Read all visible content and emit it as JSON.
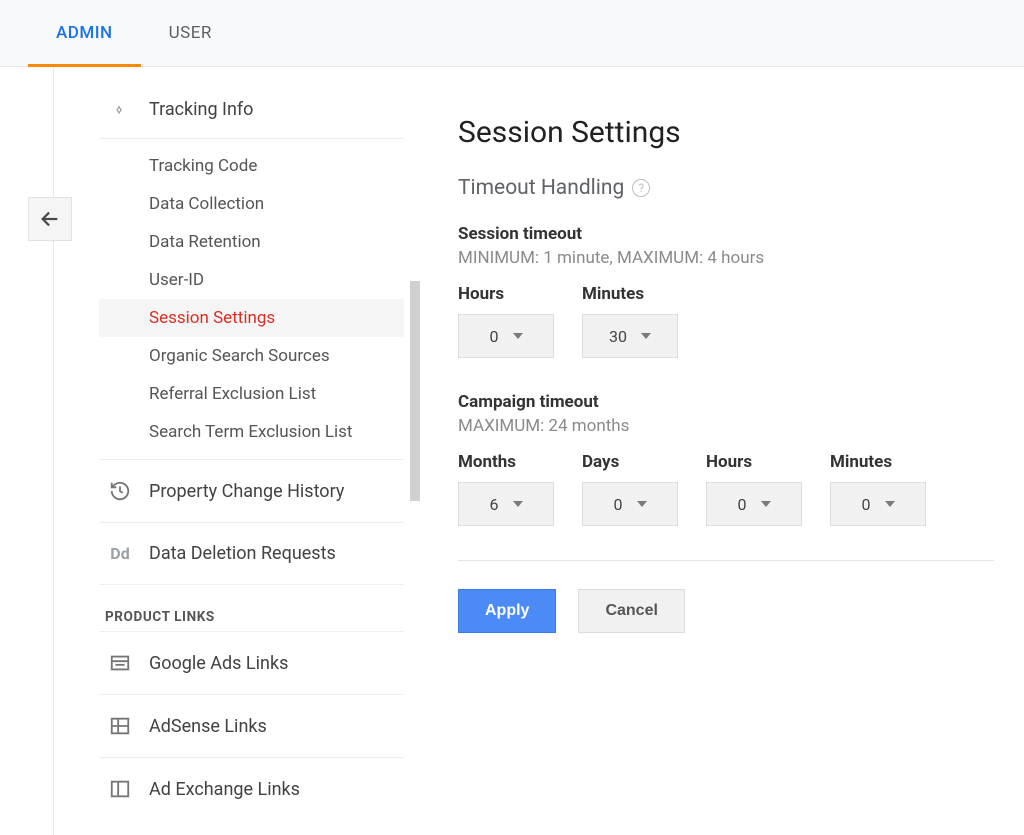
{
  "tabs": {
    "admin": "ADMIN",
    "user": "USER"
  },
  "sidebar": {
    "tracking_info": "Tracking Info",
    "items": {
      "tracking_code": "Tracking Code",
      "data_collection": "Data Collection",
      "data_retention": "Data Retention",
      "user_id": "User-ID",
      "session_settings": "Session Settings",
      "organic_search_sources": "Organic Search Sources",
      "referral_exclusion_list": "Referral Exclusion List",
      "search_term_exclusion_list": "Search Term Exclusion List"
    },
    "property_change_history": "Property Change History",
    "data_deletion_requests": "Data Deletion Requests",
    "product_links_header": "PRODUCT LINKS",
    "google_ads_links": "Google Ads Links",
    "adsense_links": "AdSense Links",
    "ad_exchange_links": "Ad Exchange Links"
  },
  "main": {
    "title": "Session Settings",
    "timeout_handling": "Timeout Handling",
    "session_timeout": {
      "label": "Session timeout",
      "limits": "MINIMUM: 1 minute, MAXIMUM: 4 hours",
      "hours_label": "Hours",
      "minutes_label": "Minutes",
      "hours_value": "0",
      "minutes_value": "30"
    },
    "campaign_timeout": {
      "label": "Campaign timeout",
      "limits": "MAXIMUM: 24 months",
      "months_label": "Months",
      "days_label": "Days",
      "hours_label": "Hours",
      "minutes_label": "Minutes",
      "months_value": "6",
      "days_value": "0",
      "hours_value": "0",
      "minutes_value": "0"
    },
    "buttons": {
      "apply": "Apply",
      "cancel": "Cancel"
    }
  }
}
